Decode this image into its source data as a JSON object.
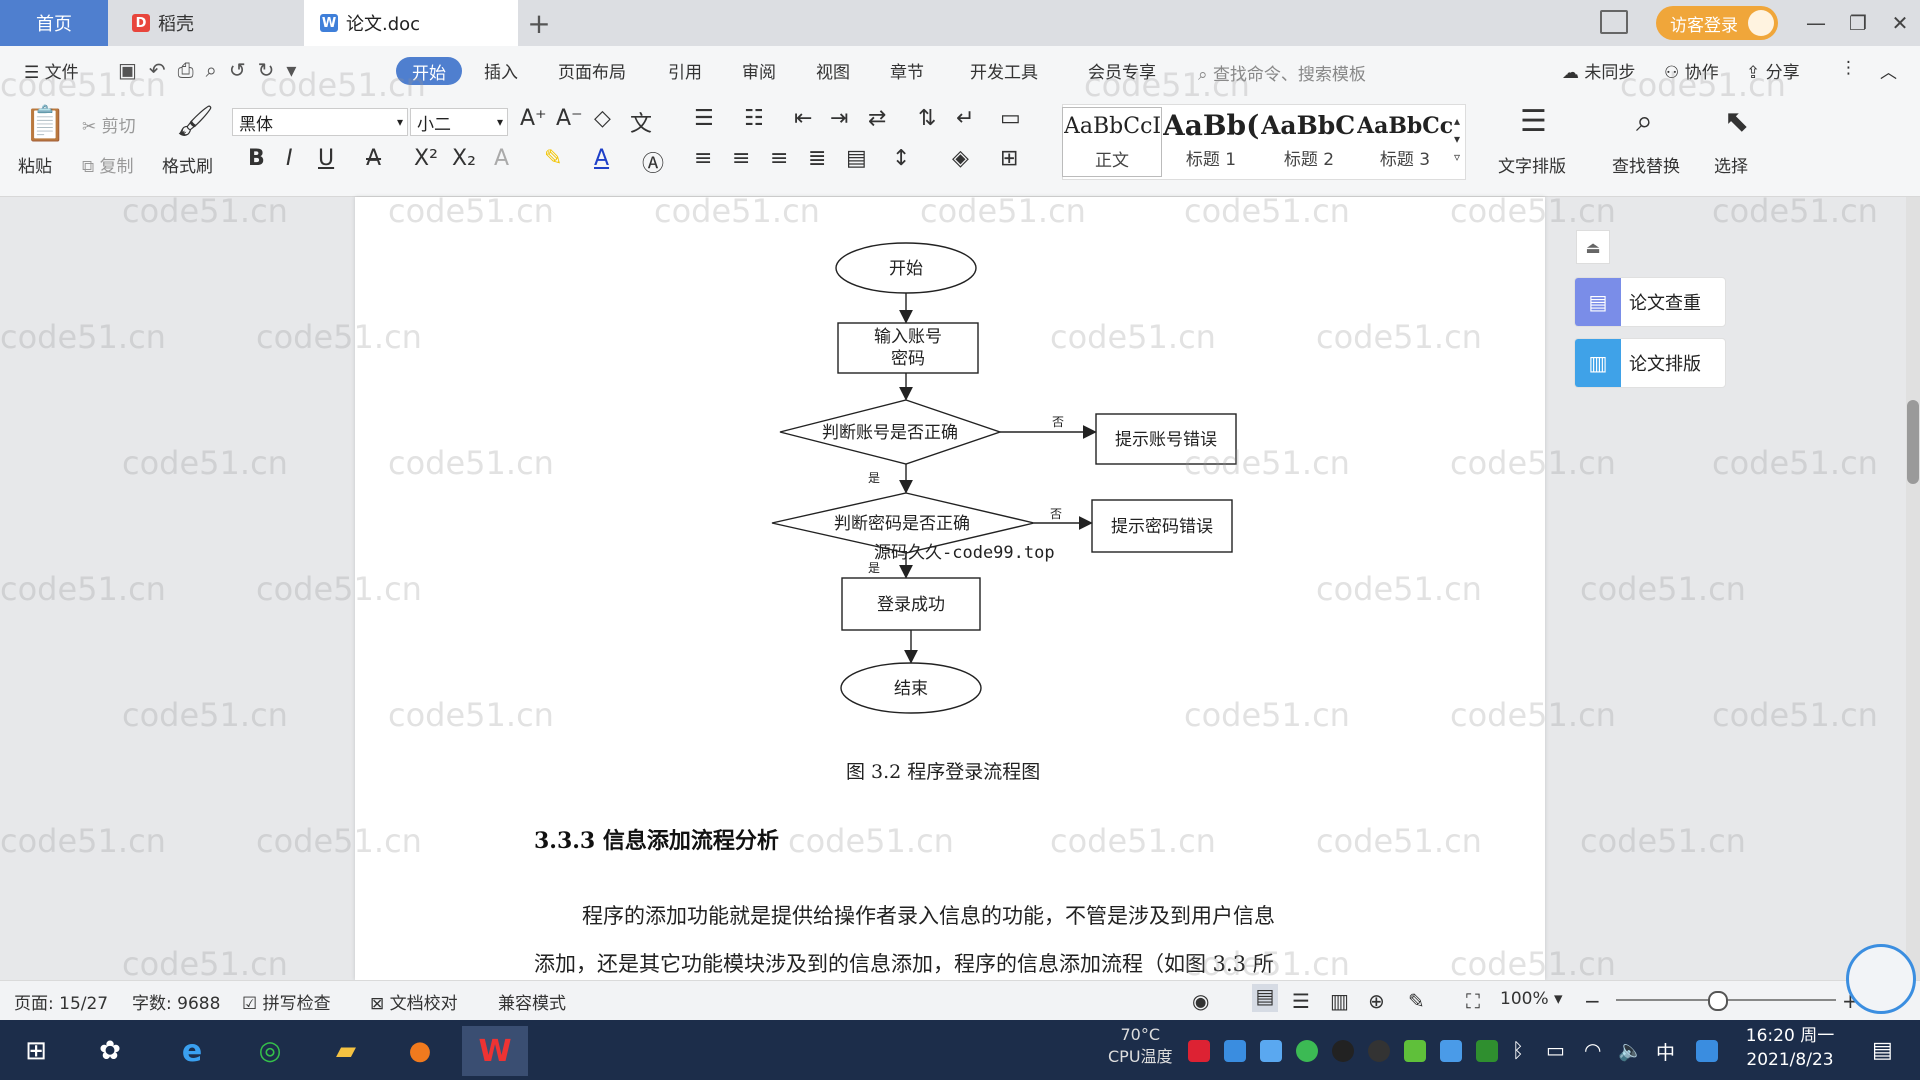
{
  "tabs": {
    "home": "首页",
    "daoke": "稻壳",
    "doc": "论文.doc",
    "add": "+"
  },
  "title_bar": {
    "visitor_login": "访客登录"
  },
  "menu": {
    "file": "文件",
    "items": [
      "开始",
      "插入",
      "页面布局",
      "引用",
      "审阅",
      "视图",
      "章节",
      "开发工具",
      "会员专享"
    ],
    "search_placeholder": "查找命令、搜索模板",
    "unsynced": "未同步",
    "collab": "协作",
    "share": "分享"
  },
  "ribbon": {
    "paste": "粘贴",
    "cut": "剪切",
    "copy": "复制",
    "format_painter": "格式刷",
    "font_name": "黑体",
    "font_size": "小二",
    "styles": [
      {
        "sample": "AaBbCcI",
        "label": "正文"
      },
      {
        "sample": "AaBb(",
        "label": "标题 1"
      },
      {
        "sample": "AaBbC",
        "label": "标题 2"
      },
      {
        "sample": "AaBbCcl",
        "label": "标题 3"
      }
    ],
    "text_layout": "文字排版",
    "find_replace": "查找替换",
    "select": "选择"
  },
  "flowchart": {
    "start": "开始",
    "input_line1": "输入账号",
    "input_line2": "密码",
    "check_account": "判断账号是否正确",
    "account_error": "提示账号错误",
    "check_password": "判断密码是否正确",
    "password_error": "提示密码错误",
    "success": "登录成功",
    "end": "结束",
    "no1": "否",
    "yes1": "是",
    "no2": "否",
    "yes2": "是",
    "overlay_watermark": "源码久久-code99.top"
  },
  "document": {
    "caption": "图 3.2 程序登录流程图",
    "heading": "3.3.3 信息添加流程分析",
    "para_line1": "程序的添加功能就是提供给操作者录入信息的功能，不管是涉及到用户信息",
    "para_line2": "添加，还是其它功能模块涉及到的信息添加，程序的信息添加流程（如图 3.3 所"
  },
  "watermark_text": "code51.cn",
  "side_panel": {
    "plagiarism_check": "论文查重",
    "thesis_format": "论文排版"
  },
  "status": {
    "page": "页面: 15/27",
    "word_count": "字数: 9688",
    "spell_check": "拼写检查",
    "doc_proof": "文档校对",
    "compat_mode": "兼容模式",
    "zoom": "100%"
  },
  "taskbar": {
    "cpu_temp": "70°C",
    "cpu_label": "CPU温度",
    "ime": "中",
    "time": "16:20 周一",
    "date": "2021/8/23"
  },
  "colors": {
    "accent": "#4f7fcf",
    "visitor": "#f0a63a",
    "taskbar": "#1c2d4a"
  }
}
